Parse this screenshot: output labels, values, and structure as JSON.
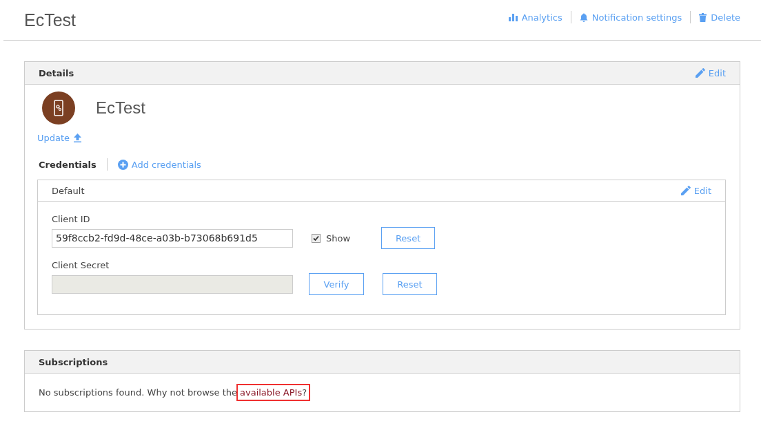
{
  "page": {
    "title": "EcTest"
  },
  "header_actions": [
    {
      "kind": "chart",
      "label": "Analytics"
    },
    {
      "kind": "bell",
      "label": "Notification settings"
    },
    {
      "kind": "trash",
      "label": "Delete"
    }
  ],
  "details": {
    "title": "Details",
    "edit": "Edit",
    "app_name": "EcTest",
    "update": "Update",
    "credentials": {
      "title": "Credentials",
      "add": "Add credentials",
      "default": {
        "title": "Default",
        "edit": "Edit",
        "client_id": {
          "label": "Client ID",
          "value": "59f8ccb2-fd9d-48ce-a03b-b73068b691d5",
          "show_checked": true,
          "show_label": "Show",
          "reset": "Reset"
        },
        "client_secret": {
          "label": "Client Secret",
          "verify": "Verify",
          "reset": "Reset"
        }
      }
    }
  },
  "subscriptions": {
    "title": "Subscriptions",
    "text": "No subscriptions found. Why not browse the",
    "link": "available APIs",
    "after": "?",
    "link_highlighted": true
  }
}
